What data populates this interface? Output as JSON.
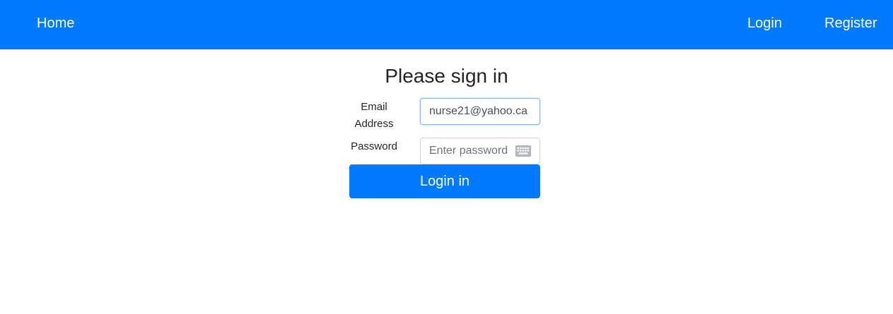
{
  "navbar": {
    "home_label": "Home",
    "login_label": "Login",
    "register_label": "Register",
    "background_color": "#007bff"
  },
  "form": {
    "title": "Please sign in",
    "email_label": "Email Address",
    "email_value": "nurse21@yahoo.ca",
    "password_label": "Password",
    "password_placeholder": "Enter password",
    "password_icon": "keyboard-icon",
    "submit_label": "Login in"
  }
}
